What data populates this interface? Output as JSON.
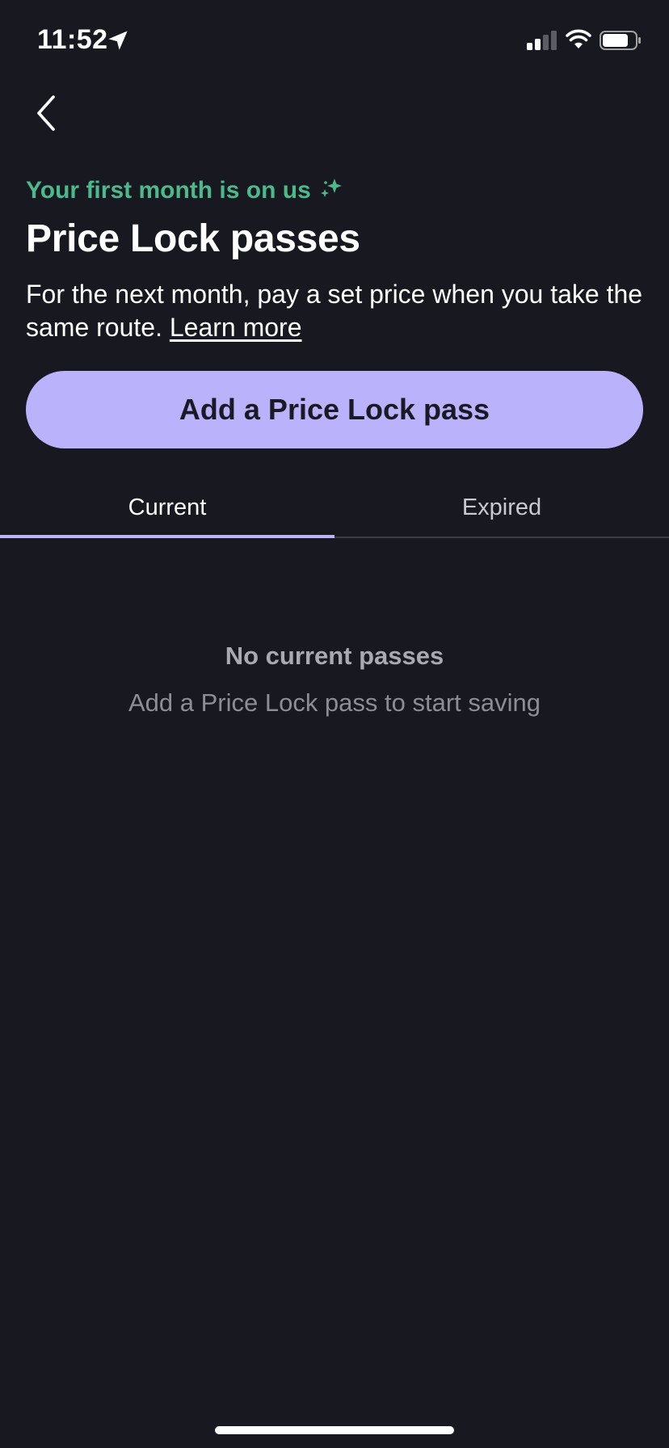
{
  "status_bar": {
    "time": "11:52"
  },
  "header": {
    "promo_text": "Your first month is on us",
    "title": "Price Lock passes",
    "description": "For the next month, pay a set price when you take the same route.",
    "learn_more_label": "Learn more"
  },
  "primary_action": {
    "label": "Add a Price Lock pass"
  },
  "tabs": [
    {
      "label": "Current",
      "selected": true
    },
    {
      "label": "Expired",
      "selected": false
    }
  ],
  "empty_state": {
    "title": "No current passes",
    "subtitle": "Add a Price Lock pass to start saving"
  },
  "colors": {
    "background": "#171820",
    "accent": "#bbb2fc",
    "promo_green": "#4db98a"
  }
}
